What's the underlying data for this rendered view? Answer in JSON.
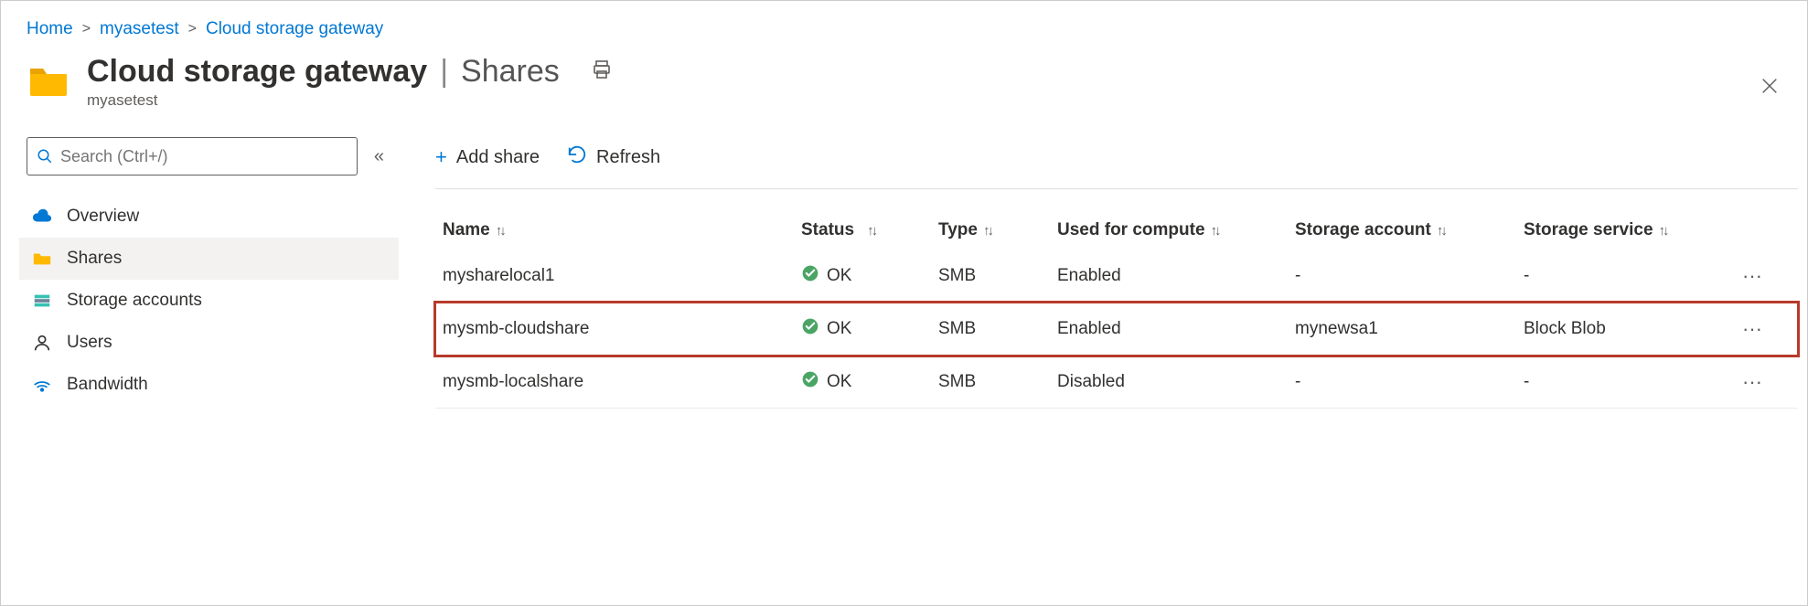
{
  "breadcrumb": {
    "home": "Home",
    "sep": ">",
    "item1": "myasetest",
    "item2": "Cloud storage gateway"
  },
  "header": {
    "title": "Cloud storage gateway",
    "divider": "|",
    "section": "Shares",
    "subtitle": "myasetest"
  },
  "search": {
    "placeholder": "Search (Ctrl+/)"
  },
  "sidebar": {
    "items": [
      {
        "label": "Overview"
      },
      {
        "label": "Shares"
      },
      {
        "label": "Storage accounts"
      },
      {
        "label": "Users"
      },
      {
        "label": "Bandwidth"
      }
    ]
  },
  "toolbar": {
    "add": "Add share",
    "refresh": "Refresh"
  },
  "table": {
    "headers": {
      "name": "Name",
      "status": "Status",
      "type": "Type",
      "compute": "Used for compute",
      "account": "Storage account",
      "service": "Storage service"
    },
    "rows": [
      {
        "name": "mysharelocal1",
        "status": "OK",
        "type": "SMB",
        "compute": "Enabled",
        "account": "-",
        "service": "-",
        "highlight": false
      },
      {
        "name": "mysmb-cloudshare",
        "status": "OK",
        "type": "SMB",
        "compute": "Enabled",
        "account": "mynewsa1",
        "service": "Block Blob",
        "highlight": true
      },
      {
        "name": "mysmb-localshare",
        "status": "OK",
        "type": "SMB",
        "compute": "Disabled",
        "account": "-",
        "service": "-",
        "highlight": false
      }
    ]
  }
}
